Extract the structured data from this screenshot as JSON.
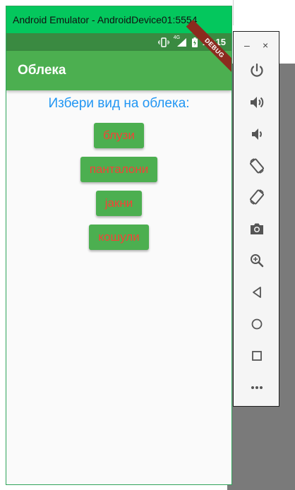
{
  "emulator": {
    "window_title": "Android Emulator - AndroidDevice01:5554"
  },
  "status_bar": {
    "time": "10:15",
    "network_label": "4G",
    "debug_banner": "DEBUG"
  },
  "app_bar": {
    "title": "Облека"
  },
  "main": {
    "prompt": "Избери вид на облека:",
    "buttons": [
      {
        "label": "блузи"
      },
      {
        "label": "панталони"
      },
      {
        "label": "јакни"
      },
      {
        "label": "кошули"
      }
    ]
  },
  "control_panel": {
    "minimize": "–",
    "close": "×",
    "tools": [
      "power-icon",
      "volume-up-icon",
      "volume-down-icon",
      "rotate-left-icon",
      "rotate-right-icon",
      "camera-icon",
      "zoom-icon",
      "back-icon",
      "home-icon",
      "overview-icon",
      "more-icon"
    ]
  },
  "colors": {
    "titlebar": "#04c75d",
    "statusbar": "#3a8a41",
    "appbar": "#4caf50",
    "prompt_text": "#2196f3",
    "button_bg": "#4caf50",
    "button_text": "#f44336"
  }
}
